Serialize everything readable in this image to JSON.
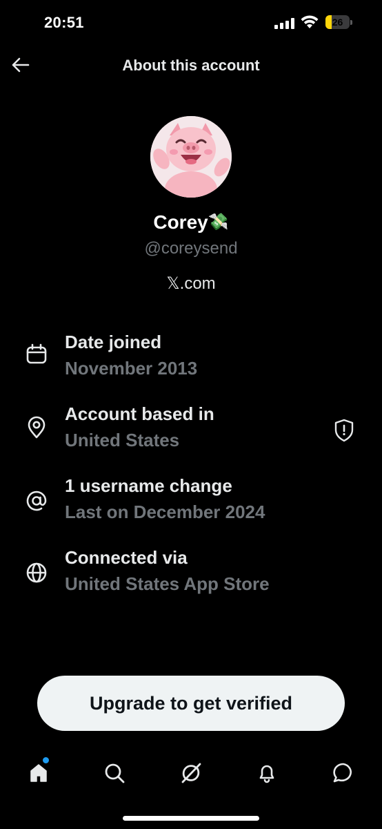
{
  "status_bar": {
    "time": "20:51",
    "battery_level": "26",
    "battery_fraction": 0.26,
    "battery_color": "#ffd60a"
  },
  "header": {
    "title": "About this account",
    "back_icon": "arrow-left-icon"
  },
  "profile": {
    "display_name": "Corey",
    "name_emoji": "💸",
    "handle": "@coreysend",
    "site": "𝕏.com",
    "avatar_icon": "pig-avatar"
  },
  "info_rows": [
    {
      "icon": "calendar-icon",
      "title": "Date joined",
      "value": "November 2013"
    },
    {
      "icon": "location-pin-icon",
      "title": "Account based in",
      "value": "United States",
      "trailing_icon": "shield-icon"
    },
    {
      "icon": "at-sign-icon",
      "title": "1 username change",
      "value": "Last on December 2024"
    },
    {
      "icon": "globe-icon",
      "title": "Connected via",
      "value": "United States App Store"
    }
  ],
  "upgrade_button": {
    "label": "Upgrade to get verified"
  },
  "bottom_nav": {
    "items": [
      "home-icon",
      "search-icon",
      "grok-icon",
      "bell-icon",
      "messages-icon"
    ],
    "active": "home-icon",
    "notification_dot_color": "#1d9bf0"
  },
  "colors": {
    "background": "#000000",
    "primary_text": "#e7e9ea",
    "secondary_text": "#71767b",
    "button_bg": "#eff3f4",
    "accent": "#1d9bf0"
  }
}
